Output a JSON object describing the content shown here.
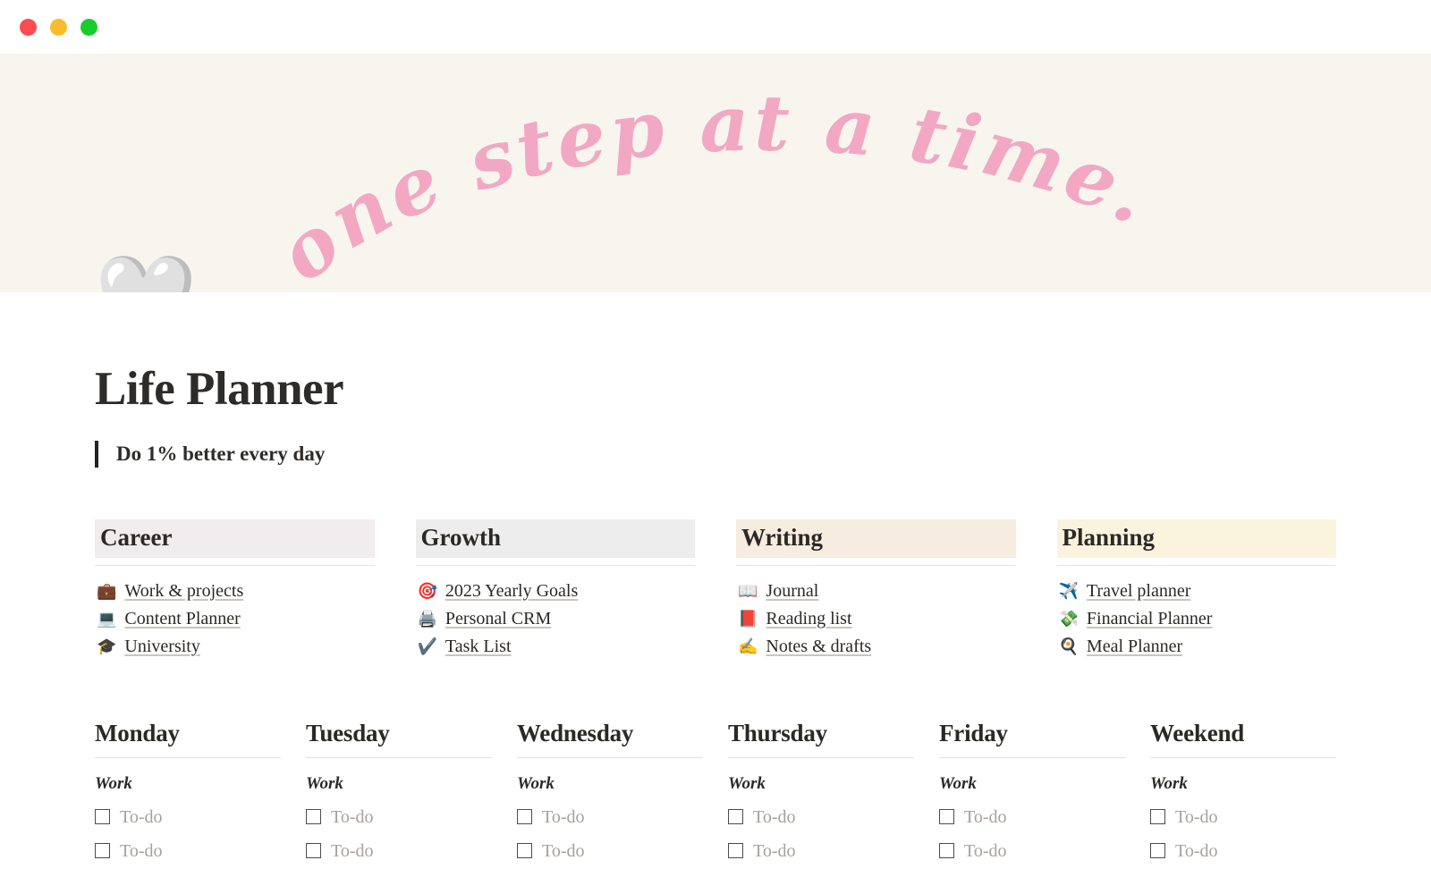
{
  "window": {
    "traffic_lights": [
      {
        "name": "close",
        "color": "#fa4c51"
      },
      {
        "name": "minimize",
        "color": "#fcbb2d"
      },
      {
        "name": "maximize",
        "color": "#19cc2d"
      }
    ]
  },
  "banner": {
    "background_color": "#f8f5ef",
    "text_color": "#f2a8c3",
    "arc_text": "one step at a time."
  },
  "page": {
    "icon": "🤍",
    "icon_name": "white-heart-icon",
    "title": "Life Planner",
    "subtitle": "Do 1% better every day"
  },
  "link_columns": [
    {
      "heading": "Career",
      "heading_bg": "#f1ecee",
      "items": [
        {
          "emoji": "💼",
          "icon_name": "briefcase-icon",
          "label": "Work & projects"
        },
        {
          "emoji": "💻",
          "icon_name": "laptop-icon",
          "label": "Content Planner"
        },
        {
          "emoji": "🎓",
          "icon_name": "graduation-cap-icon",
          "label": "University"
        }
      ]
    },
    {
      "heading": "Growth",
      "heading_bg": "#eeeded",
      "items": [
        {
          "emoji": "🎯",
          "icon_name": "target-icon",
          "label": "2023 Yearly Goals"
        },
        {
          "emoji": "🖨️",
          "icon_name": "printer-icon",
          "label": "Personal CRM"
        },
        {
          "emoji": "✔️",
          "icon_name": "check-mark-icon",
          "label": "Task List"
        }
      ]
    },
    {
      "heading": "Writing",
      "heading_bg": "#f6ece0",
      "items": [
        {
          "emoji": "📖",
          "icon_name": "open-book-icon",
          "label": "Journal"
        },
        {
          "emoji": "📕",
          "icon_name": "closed-book-icon",
          "label": "Reading list"
        },
        {
          "emoji": "✍️",
          "icon_name": "writing-hand-icon",
          "label": "Notes & drafts"
        }
      ]
    },
    {
      "heading": "Planning",
      "heading_bg": "#faf3de",
      "items": [
        {
          "emoji": "✈️",
          "icon_name": "airplane-icon",
          "label": "Travel planner"
        },
        {
          "emoji": "💸",
          "icon_name": "money-wings-icon",
          "label": "Financial Planner"
        },
        {
          "emoji": "🍳",
          "icon_name": "cooking-pan-icon",
          "label": "Meal Planner"
        }
      ]
    }
  ],
  "week_columns": [
    {
      "day": "Monday",
      "section": "Work",
      "todos": [
        "To-do",
        "To-do"
      ]
    },
    {
      "day": "Tuesday",
      "section": "Work",
      "todos": [
        "To-do",
        "To-do"
      ]
    },
    {
      "day": "Wednesday",
      "section": "Work",
      "todos": [
        "To-do",
        "To-do"
      ]
    },
    {
      "day": "Thursday",
      "section": "Work",
      "todos": [
        "To-do",
        "To-do"
      ]
    },
    {
      "day": "Friday",
      "section": "Work",
      "todos": [
        "To-do",
        "To-do"
      ]
    },
    {
      "day": "Weekend",
      "section": "Work",
      "todos": [
        "To-do",
        "To-do"
      ]
    }
  ]
}
